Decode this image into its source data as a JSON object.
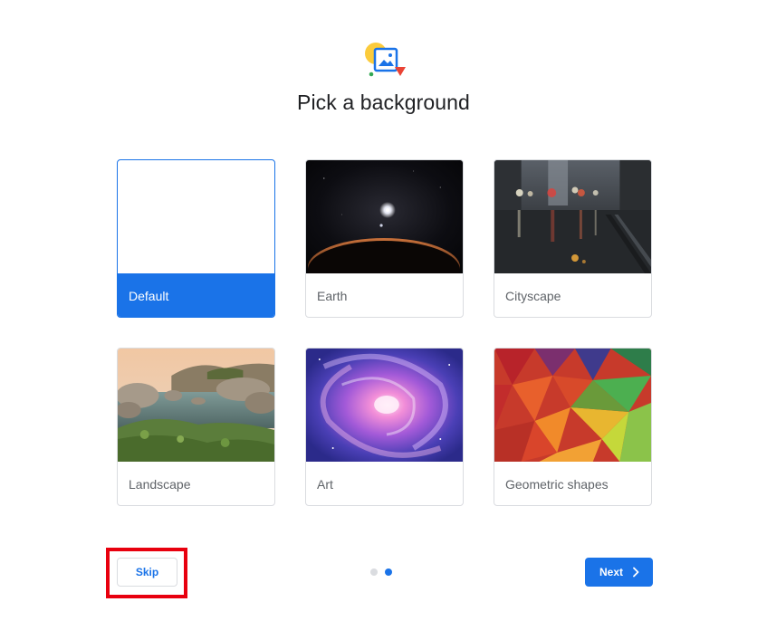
{
  "title": "Pick a background",
  "cards": [
    {
      "label": "Default",
      "selected": true
    },
    {
      "label": "Earth",
      "selected": false
    },
    {
      "label": "Cityscape",
      "selected": false
    },
    {
      "label": "Landscape",
      "selected": false
    },
    {
      "label": "Art",
      "selected": false
    },
    {
      "label": "Geometric shapes",
      "selected": false
    }
  ],
  "buttons": {
    "skip_label": "Skip",
    "next_label": "Next"
  },
  "pager": {
    "total": 2,
    "current": 2
  },
  "colors": {
    "accent": "#1a73e8",
    "highlight": "#e8000e",
    "title": "#202124",
    "label": "#5f6368"
  },
  "icons": {
    "logo": "background-picker-icon",
    "next": "chevron-right-icon"
  }
}
